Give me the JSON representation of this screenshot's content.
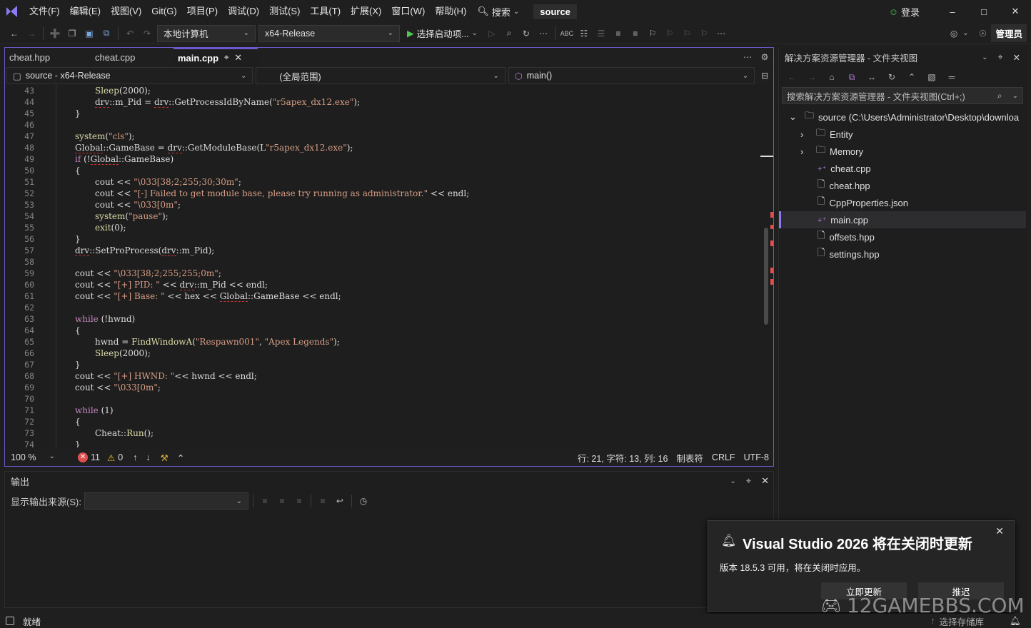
{
  "menu": {
    "items": [
      "文件(F)",
      "编辑(E)",
      "视图(V)",
      "Git(G)",
      "项目(P)",
      "调试(D)",
      "测试(S)",
      "工具(T)",
      "扩展(X)",
      "窗口(W)",
      "帮助(H)"
    ],
    "search_label": "搜索",
    "solution_name": "source",
    "login_label": "登录"
  },
  "toolbar": {
    "machine_combo": "本地计算机",
    "config_combo": "x64-Release",
    "startup_label": "选择启动项...",
    "admin_label": "管理员"
  },
  "editor": {
    "tabs": [
      {
        "label": "cheat.hpp",
        "active": false
      },
      {
        "label": "cheat.cpp",
        "active": false
      },
      {
        "label": "main.cpp",
        "active": true
      }
    ],
    "nav_project": "source - x64-Release",
    "nav_scope": "(全局范围)",
    "nav_member": "main()",
    "line_numbers": [
      "43",
      "44",
      "45",
      "46",
      "47",
      "48",
      "49",
      "50",
      "51",
      "52",
      "53",
      "54",
      "55",
      "56",
      "57",
      "58",
      "59",
      "60",
      "61",
      "62",
      "63",
      "64",
      "65",
      "66",
      "67",
      "68",
      "69",
      "70",
      "71",
      "72",
      "73",
      "74"
    ],
    "status": {
      "zoom": "100 %",
      "errors": "11",
      "warnings": "0",
      "position": "行: 21, 字符: 13, 列: 16",
      "indent": "制表符",
      "eol": "CRLF",
      "encoding": "UTF-8"
    }
  },
  "output": {
    "title": "输出",
    "source_label": "显示输出来源(S):"
  },
  "solution_explorer": {
    "title": "解决方案资源管理器 - 文件夹视图",
    "search_placeholder": "搜索解决方案资源管理器 - 文件夹视图(Ctrl+;)",
    "root": "source (C:\\Users\\Administrator\\Desktop\\downloa",
    "items": [
      {
        "label": "Entity",
        "icon": "folder-icon"
      },
      {
        "label": "Memory",
        "icon": "folder-icon"
      },
      {
        "label": "cheat.cpp",
        "icon": "cpp-file-icon"
      },
      {
        "label": "cheat.hpp",
        "icon": "header-file-icon"
      },
      {
        "label": "CppProperties.json",
        "icon": "json-file-icon"
      },
      {
        "label": "main.cpp",
        "icon": "cpp-file-icon"
      },
      {
        "label": "offsets.hpp",
        "icon": "header-file-icon"
      },
      {
        "label": "settings.hpp",
        "icon": "header-file-icon"
      }
    ]
  },
  "notification": {
    "title": "Visual Studio 2026 将在关闭时更新",
    "body": "版本 18.5.3 可用，将在关闭时应用。",
    "update_button": "立即更新",
    "postpone_button": "推迟"
  },
  "statusbar": {
    "ready": "就绪",
    "repo_label": "选择存储库"
  },
  "watermark": "12GAMEBBS.COM",
  "colors": {
    "accent": "#6a5acd",
    "background": "#1f1f1f",
    "string": "#d69d85",
    "keyword": "#c586c0",
    "error": "#e05050"
  }
}
